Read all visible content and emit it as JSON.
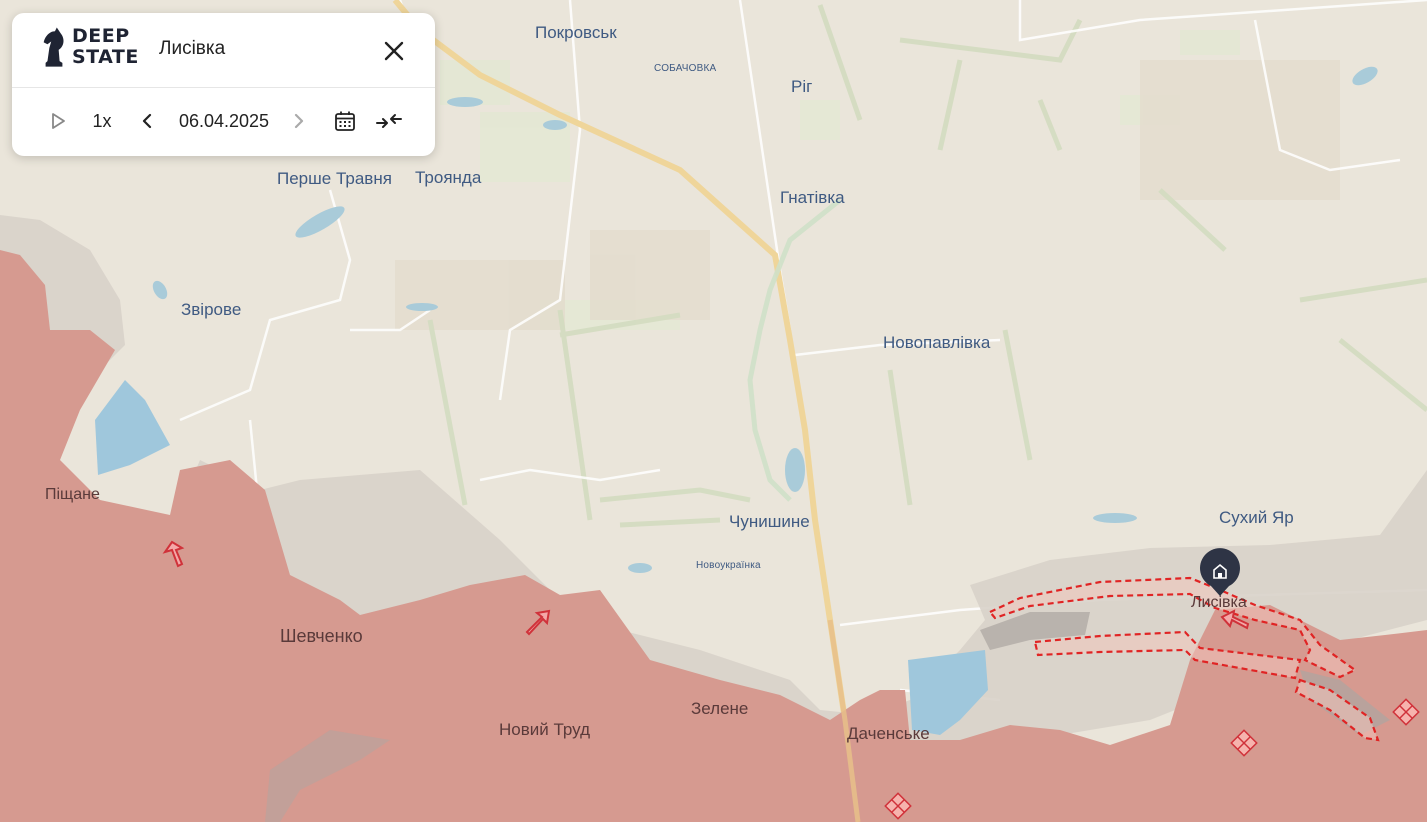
{
  "brand": {
    "line1": "DEEP",
    "line2": "STATE"
  },
  "panel": {
    "title": "Лисівка",
    "speed": "1x",
    "date": "06.04.2025"
  },
  "icons": {
    "logo": "knight-chess-icon",
    "close": "close-icon",
    "play": "play-icon",
    "prev": "chevron-left-icon",
    "next": "chevron-right-icon",
    "calendar": "calendar-icon",
    "collapse": "collapse-arrows-icon",
    "marker": "home-pin-icon"
  },
  "colors": {
    "occupied": "#d69a90",
    "grey_zone": "#d7d0c8",
    "contested_outline": "#e02424",
    "water": "#9fc7dc",
    "highway": "#efd59a",
    "marker": "#2e3445"
  },
  "places": [
    {
      "id": "pokrovsk",
      "name": "Покровськ"
    },
    {
      "id": "sobachovka",
      "name": "СОБАЧОВКА"
    },
    {
      "id": "rig",
      "name": "Ріг"
    },
    {
      "id": "pershe-travnia",
      "name": "Перше Травня"
    },
    {
      "id": "troianda",
      "name": "Троянда"
    },
    {
      "id": "hnativka",
      "name": "Гнатівка"
    },
    {
      "id": "zvirove",
      "name": "Звірове"
    },
    {
      "id": "novopavlivka",
      "name": "Новопавлівка"
    },
    {
      "id": "pishchane",
      "name": "Піщане"
    },
    {
      "id": "chunyshyne",
      "name": "Чунишине"
    },
    {
      "id": "sukhyi-yar",
      "name": "Сухий Яр"
    },
    {
      "id": "novoukrainka",
      "name": "Новоукраїнка"
    },
    {
      "id": "lysivka",
      "name": "Лисівка"
    },
    {
      "id": "shevchenko",
      "name": "Шевченко"
    },
    {
      "id": "zelene",
      "name": "Зелене"
    },
    {
      "id": "novyi-trud",
      "name": "Новий Труд"
    },
    {
      "id": "dachenske",
      "name": "Даченське"
    }
  ]
}
